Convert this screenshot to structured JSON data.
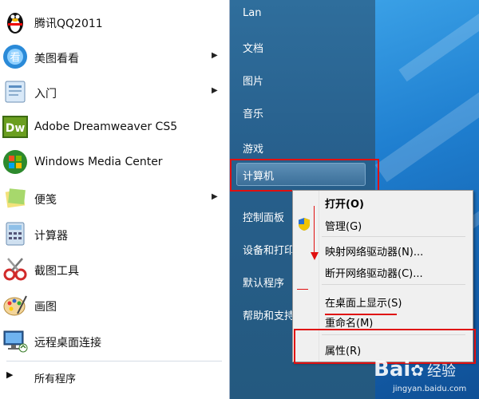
{
  "start_menu": {
    "programs": [
      {
        "label": "腾讯QQ2011",
        "icon": "qq-penguin-icon",
        "submenu": false
      },
      {
        "label": "美图看看",
        "icon": "meitu-viewer-icon",
        "submenu": true
      },
      {
        "label": "入门",
        "icon": "getting-started-icon",
        "submenu": true
      },
      {
        "label": "Adobe Dreamweaver CS5",
        "icon": "dreamweaver-icon",
        "submenu": false
      },
      {
        "label": "Windows Media Center",
        "icon": "windows-logo-icon",
        "submenu": false
      },
      {
        "label": "便笺",
        "icon": "sticky-notes-icon",
        "submenu": true
      },
      {
        "label": "计算器",
        "icon": "calculator-icon",
        "submenu": false
      },
      {
        "label": "截图工具",
        "icon": "snipping-tool-icon",
        "submenu": false
      },
      {
        "label": "画图",
        "icon": "paint-icon",
        "submenu": false
      },
      {
        "label": "远程桌面连接",
        "icon": "remote-desktop-icon",
        "submenu": false
      }
    ],
    "all_programs": "所有程序",
    "right_pane": {
      "user": "Lan",
      "documents": "文档",
      "pictures": "图片",
      "music": "音乐",
      "games": "游戏",
      "computer": "计算机",
      "control_panel": "控制面板",
      "devices_printers": "设备和打印",
      "default_programs": "默认程序",
      "help": "帮助和支持"
    }
  },
  "context_menu": {
    "items": [
      "打开(O)",
      "管理(G)",
      "映射网络驱动器(N)...",
      "断开网络驱动器(C)...",
      "在桌面上显示(S)",
      "重命名(M)",
      "属性(R)"
    ]
  },
  "watermark": {
    "brand": "Bai",
    "brand2": "经验",
    "url": "jingyan.baidu.com"
  },
  "colors": {
    "highlight_red": "#e01010",
    "right_pane": "#2a6794"
  }
}
